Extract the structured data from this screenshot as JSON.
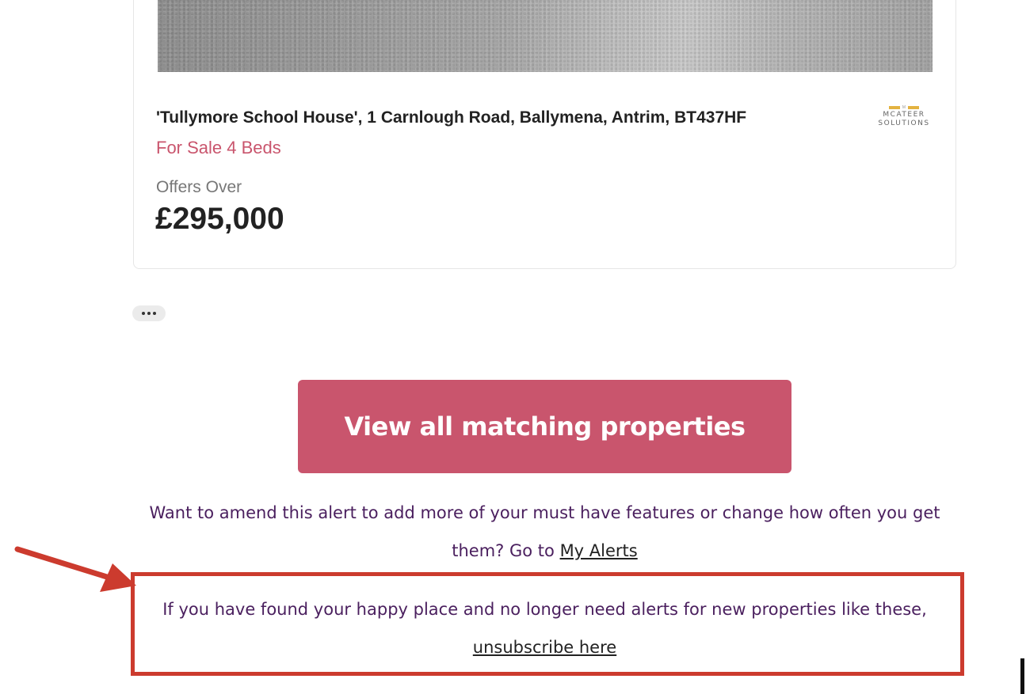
{
  "listing": {
    "address": "'Tullymore School House', 1 Carnlough Road, Ballymena, Antrim, BT437HF",
    "sale_info": "For Sale 4 Beds",
    "price_qualifier": "Offers Over",
    "price": "£295,000",
    "agent_logo": {
      "name": "MCATEER SOLUTIONS"
    }
  },
  "cta": {
    "label": "View all matching properties"
  },
  "amend": {
    "text": "Want to amend this alert to add more of your must have features or change how often you get them? Go to ",
    "link_label": "My Alerts"
  },
  "unsubscribe": {
    "text": "If you have found your happy place and no longer need alerts for new properties like these,",
    "link_label": "unsubscribe here"
  },
  "colors": {
    "accent_pink": "#c9556d",
    "body_text_purple": "#4a1f5e",
    "annotation_red": "#cc3b2e"
  }
}
